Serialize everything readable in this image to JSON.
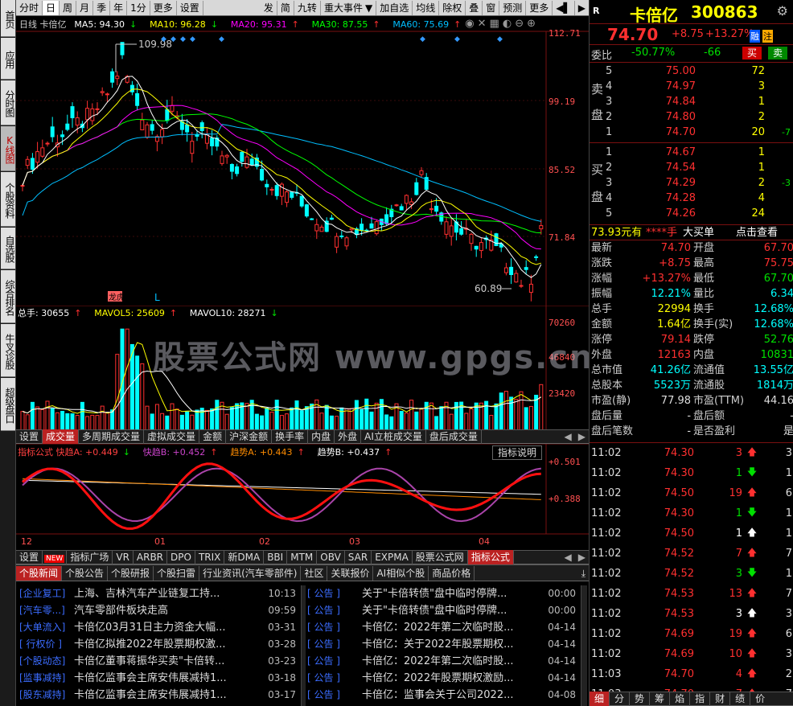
{
  "left_tabs": [
    "首页",
    "应用",
    "分时图",
    "K线图",
    "个股资料",
    "自选股",
    "综合排名",
    "牛叉诊股",
    "超级盘口"
  ],
  "top_toolbar": {
    "left": [
      "分时",
      "日",
      "周",
      "月",
      "季",
      "年",
      "1分",
      "更多",
      "设置"
    ],
    "right": [
      "发",
      "简",
      "九转",
      "重大事件",
      "加自选",
      "均线",
      "除权",
      "叠",
      "窗",
      "预测",
      "更多"
    ]
  },
  "kline": {
    "legend_prefix": "日线  卡倍亿",
    "ma": [
      {
        "label": "MA5: 94.30",
        "arrow": "↓",
        "color": "#ffffff"
      },
      {
        "label": "MA10: 96.28",
        "arrow": "↓",
        "color": "#ffff00"
      },
      {
        "label": "MA20: 95.31",
        "arrow": "↑",
        "color": "#ff00ff"
      },
      {
        "label": "MA30: 87.55",
        "arrow": "↑",
        "color": "#00ff00"
      },
      {
        "label": "MA60: 75.69",
        "arrow": "↑",
        "color": "#00bfff"
      }
    ],
    "price_axis": [
      "112.71",
      "99.19",
      "85.52",
      "71.84"
    ],
    "high_marker": "109.98",
    "low_marker": "60.89",
    "marks": [
      "龙虎榜",
      "L"
    ]
  },
  "volume": {
    "legend": [
      {
        "label": "总手: 30655",
        "arrow": "↑",
        "color": "#ffffff"
      },
      {
        "label": "MAVOL5: 25609",
        "arrow": "↑",
        "color": "#ffff00"
      },
      {
        "label": "MAVOL10: 28271",
        "arrow": "↓",
        "color": "#ffffff"
      }
    ],
    "axis": [
      "70260",
      "46840",
      "23420"
    ]
  },
  "watermark": "股票公式网  www.gpgs.cn",
  "mid_tabs": [
    "设置",
    "成交量",
    "多周期成交量",
    "虚拟成交量",
    "金额",
    "沪深金额",
    "换手率",
    "内盘",
    "外盘",
    "AI立桩成交量",
    "盘后成交量"
  ],
  "indicator": {
    "legend": [
      {
        "label": "指标公式 快趋A: +0.449",
        "arrow": "↓",
        "color": "#ff4040"
      },
      {
        "label": "快趋B: +0.452",
        "arrow": "↑",
        "color": "#cc44cc"
      },
      {
        "label": "趋势A: +0.443",
        "arrow": "↑",
        "color": "#ff8c00"
      },
      {
        "label": "趋势B: +0.437",
        "arrow": "↑",
        "color": "#ffffff"
      }
    ],
    "help": "指标说明",
    "axis": [
      "+0.501",
      "+0.388"
    ],
    "months": [
      "12",
      "01",
      "02",
      "03",
      "04"
    ]
  },
  "bottom_tabs": [
    "设置",
    "NEW",
    "指标广场",
    "VR",
    "ARBR",
    "DPO",
    "TRIX",
    "新DMA",
    "BBI",
    "MTM",
    "OBV",
    "SAR",
    "EXPMA",
    "股票公式网",
    "指标公式"
  ],
  "news_tabs": [
    "个股新闻",
    "个股公告",
    "个股研报",
    "个股扫雷",
    "行业资讯(汽车零部件)",
    "社区",
    "关联报价",
    "AI相似个股",
    "商品价格"
  ],
  "news_left": [
    {
      "tag": "[企业复工]",
      "title": "上海、吉林汽车产业链复工持...",
      "time": "10:13"
    },
    {
      "tag": "[汽车零...]",
      "title": "汽车零部件板块走高",
      "time": "09:59"
    },
    {
      "tag": "[大单流入]",
      "title": "卡倍亿03月31日主力资金大幅...",
      "time": "03-31"
    },
    {
      "tag": "[ 行权价 ]",
      "title": "卡倍亿拟推2022年股票期权激...",
      "time": "03-28"
    },
    {
      "tag": "[个股动态]",
      "title": "卡倍亿董事蒋振华买卖\"卡倍转...",
      "time": "03-23"
    },
    {
      "tag": "[监事减持]",
      "title": "卡倍亿监事会主席安伟展减持1...",
      "time": "03-18"
    },
    {
      "tag": "[股东减持]",
      "title": "卡倍亿监事会主席安伟展减持1...",
      "time": "03-17"
    }
  ],
  "news_right": [
    {
      "tag": "[   公告   ]",
      "title": "关于\"卡倍转债\"盘中临时停牌...",
      "time": "00:00"
    },
    {
      "tag": "[   公告   ]",
      "title": "关于\"卡倍转债\"盘中临时停牌...",
      "time": "00:00"
    },
    {
      "tag": "[   公告   ]",
      "title": "卡倍亿：2022年第二次临时股...",
      "time": "04-14"
    },
    {
      "tag": "[   公告   ]",
      "title": "卡倍亿：关于2022年股票期权...",
      "time": "04-14"
    },
    {
      "tag": "[   公告   ]",
      "title": "卡倍亿：2022年第二次临时股...",
      "time": "04-14"
    },
    {
      "tag": "[   公告   ]",
      "title": "卡倍亿：2022年股票期权激励...",
      "time": "04-14"
    },
    {
      "tag": "[   公告   ]",
      "title": "卡倍亿：监事会关于公司2022...",
      "time": "04-08"
    }
  ],
  "quote": {
    "r": "R",
    "name": "卡倍亿",
    "code": "300863",
    "price": "74.70",
    "change": "+8.75",
    "pct": "+13.27%",
    "tag1": "融",
    "tag2": "注",
    "wb_label": "委比",
    "wb_pct": "-50.77%",
    "wb_diff": "-66",
    "buy_btn": "买",
    "sell_btn": "卖",
    "sell_label": [
      "卖",
      "盘"
    ],
    "buy_label": [
      "买",
      "盘"
    ],
    "asks": [
      {
        "lvl": "5",
        "price": "75.00",
        "vol": "72",
        "chg": ""
      },
      {
        "lvl": "4",
        "price": "74.97",
        "vol": "3",
        "chg": ""
      },
      {
        "lvl": "3",
        "price": "74.84",
        "vol": "1",
        "chg": ""
      },
      {
        "lvl": "2",
        "price": "74.80",
        "vol": "2",
        "chg": ""
      },
      {
        "lvl": "1",
        "price": "74.70",
        "vol": "20",
        "chg": "-7"
      }
    ],
    "bids": [
      {
        "lvl": "1",
        "price": "74.67",
        "vol": "1",
        "chg": ""
      },
      {
        "lvl": "2",
        "price": "74.54",
        "vol": "1",
        "chg": ""
      },
      {
        "lvl": "3",
        "price": "74.29",
        "vol": "2",
        "chg": "-3"
      },
      {
        "lvl": "4",
        "price": "74.28",
        "vol": "4",
        "chg": ""
      },
      {
        "lvl": "5",
        "price": "74.26",
        "vol": "24",
        "chg": ""
      }
    ],
    "avg_line": [
      "73.93元有",
      "****手",
      "大买单",
      "点击查看"
    ],
    "stats": [
      [
        "最新",
        "74.70",
        "开盘",
        "67.70"
      ],
      [
        "涨跌",
        "+8.75",
        "最高",
        "75.75"
      ],
      [
        "涨幅",
        "+13.27%",
        "最低",
        "67.70"
      ],
      [
        "振幅",
        "12.21%",
        "量比",
        "6.34"
      ],
      [
        "总手",
        "22994",
        "换手",
        "12.68%"
      ],
      [
        "金额",
        "1.64亿",
        "换手(实)",
        "12.68%"
      ],
      [
        "涨停",
        "79.14",
        "跌停",
        "52.76"
      ],
      [
        "外盘",
        "12163",
        "内盘",
        "10831"
      ],
      [
        "总市值",
        "41.26亿",
        "流通值",
        "13.55亿"
      ],
      [
        "总股本",
        "5523万",
        "流通股",
        "1814万"
      ],
      [
        "市盈(静)",
        "77.98",
        "市盈(TTM)",
        "44.16"
      ],
      [
        "盘后量",
        "-",
        "盘后额",
        "-"
      ],
      [
        "盘后笔数",
        "-",
        "是否盈利",
        "是"
      ]
    ],
    "ticks": [
      {
        "t": "11:02",
        "p": "74.30",
        "v": "3",
        "dir": "up",
        "n": "3"
      },
      {
        "t": "11:02",
        "p": "74.30",
        "v": "1",
        "dir": "down",
        "n": "1"
      },
      {
        "t": "11:02",
        "p": "74.50",
        "v": "19",
        "dir": "up",
        "n": "6"
      },
      {
        "t": "11:02",
        "p": "74.30",
        "v": "1",
        "dir": "down",
        "n": "1"
      },
      {
        "t": "11:02",
        "p": "74.50",
        "v": "1",
        "dir": "white",
        "n": "1"
      },
      {
        "t": "11:02",
        "p": "74.52",
        "v": "7",
        "dir": "up",
        "n": "7"
      },
      {
        "t": "11:02",
        "p": "74.52",
        "v": "3",
        "dir": "down",
        "n": "1"
      },
      {
        "t": "11:02",
        "p": "74.53",
        "v": "13",
        "dir": "up",
        "n": "7"
      },
      {
        "t": "11:02",
        "p": "74.53",
        "v": "3",
        "dir": "white",
        "n": "3"
      },
      {
        "t": "11:02",
        "p": "74.69",
        "v": "19",
        "dir": "up",
        "n": "6"
      },
      {
        "t": "11:02",
        "p": "74.69",
        "v": "10",
        "dir": "up",
        "n": "3"
      },
      {
        "t": "11:03",
        "p": "74.70",
        "v": "4",
        "dir": "up",
        "n": "2"
      },
      {
        "t": "11:03",
        "p": "74.70",
        "v": "7",
        "dir": "up",
        "n": "7"
      }
    ],
    "bottom_tabs": [
      "细",
      "分",
      "势",
      "筹",
      "焰",
      "指",
      "财",
      "绩",
      "价"
    ]
  }
}
